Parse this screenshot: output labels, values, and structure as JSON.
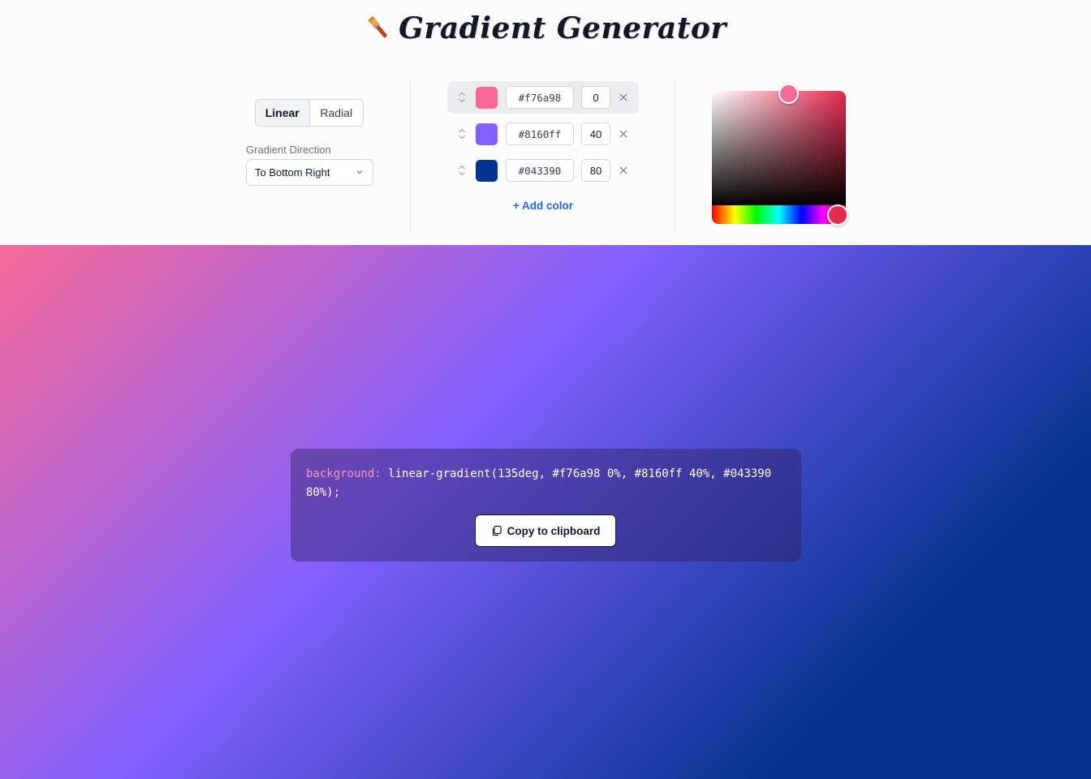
{
  "header": {
    "title": "Gradient Generator",
    "icon": "paintbrush-icon"
  },
  "controls": {
    "types": [
      {
        "label": "Linear",
        "active": true
      },
      {
        "label": "Radial",
        "active": false
      }
    ],
    "direction_label": "Gradient Direction",
    "direction_value": "To Bottom Right"
  },
  "stops": [
    {
      "hex": "#f76a98",
      "position": "0",
      "selected": true
    },
    {
      "hex": "#8160ff",
      "position": "40",
      "selected": false
    },
    {
      "hex": "#043390",
      "position": "80",
      "selected": false
    }
  ],
  "add_color_label": "+ Add color",
  "picker": {
    "color": "#f76a98",
    "hue_color": "#e8294f"
  },
  "output": {
    "property": "background:",
    "value": "linear-gradient(135deg, #f76a98 0%, #8160ff 40%, #043390 80%);",
    "copy_label": "Copy to clipboard"
  },
  "colors": {
    "accent": "#2563eb",
    "property_text": "#f59ab8"
  }
}
